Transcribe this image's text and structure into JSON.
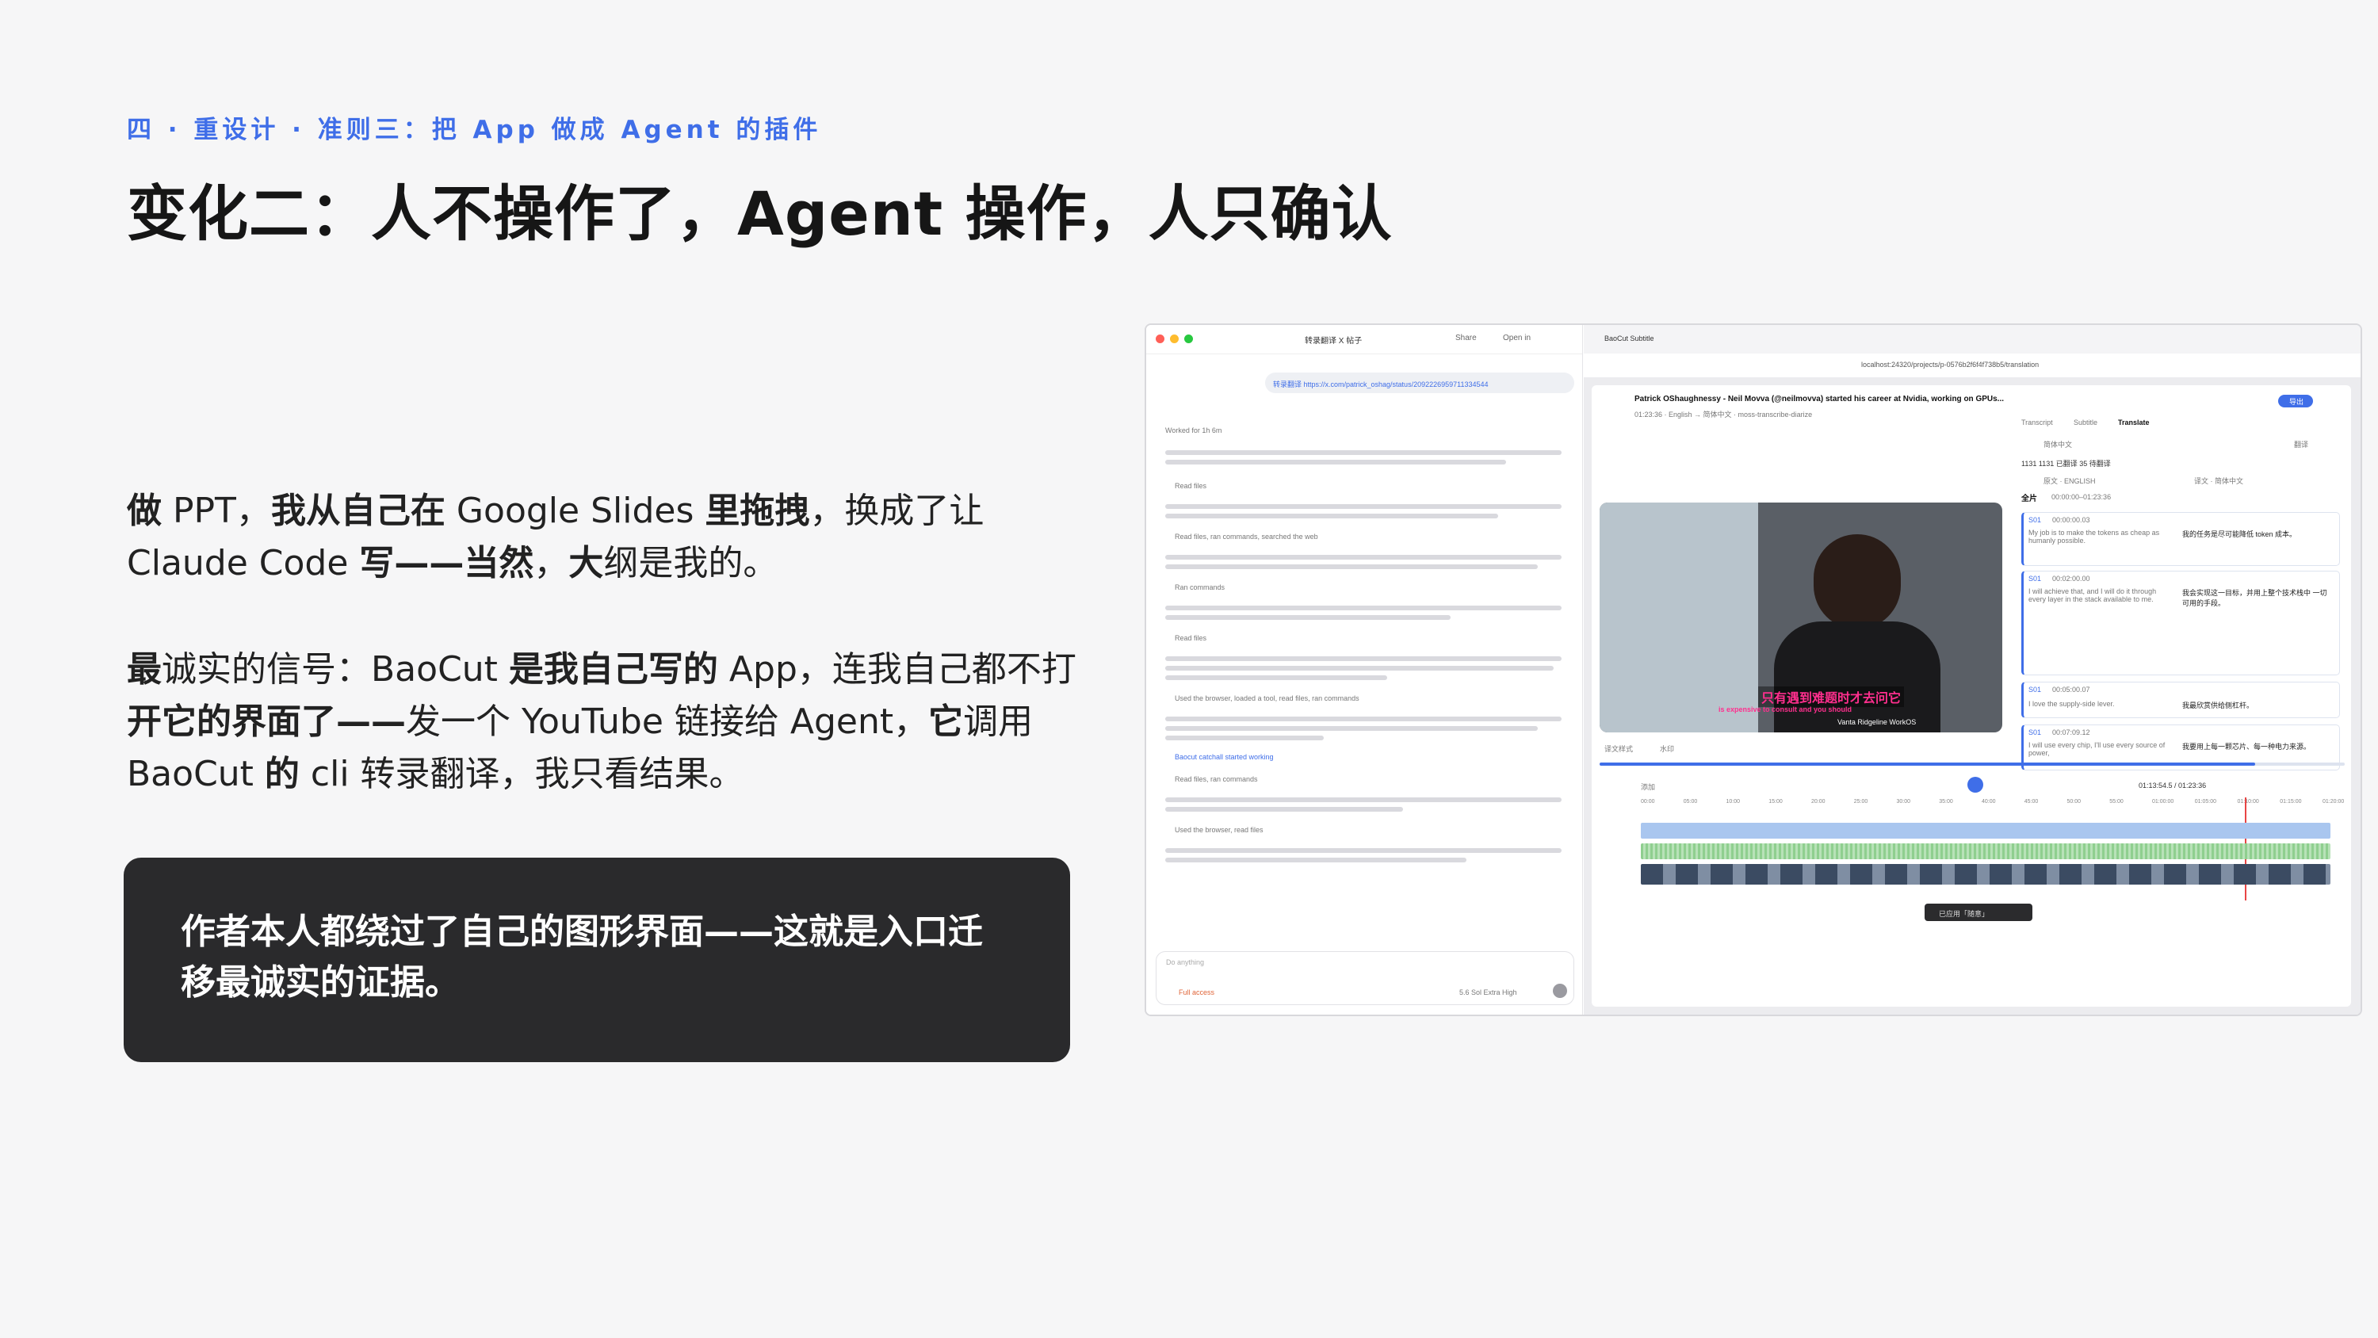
{
  "slide": {
    "kicker": "四 · 重设计 · 准则三：把 App 做成 Agent 的插件",
    "title": "变化二：人不操作了，Agent 操作，人只确认",
    "p1": {
      "b1": "做",
      "t1": " PPT，",
      "b2": "我从自己在",
      "t2": " Google Slides ",
      "b3": "里拖拽",
      "t3": "，换成了让 Claude Code ",
      "b4": "写——当然",
      "t4": "，",
      "b5": "大",
      "t5": "纲是我的。"
    },
    "p2": {
      "b1": "最",
      "t1": "诚实的信号：BaoCut ",
      "b2": "是我自己写的",
      "t2": " App，连我自己都不打",
      "b3": "开它的界面了——",
      "t3": "发一个 YouTube 链接给 Agent，",
      "b4": "它",
      "t4": "调用 BaoCut ",
      "b5": "的",
      "t5": " cli 转录翻译，我只看结果。"
    },
    "callout": "作者本人都绕过了自己的图形界面——这就是入口迁移最诚实的证据。"
  },
  "screenshot": {
    "left": {
      "tab": "转录翻译 X 帖子",
      "share": "Share",
      "open_in": "Open in",
      "msg": "转录翻译 https://x.com/patrick_oshag/status/2092226959711334544",
      "worked": "Worked for 1h 6m",
      "read_files": "Read files",
      "read_ran_web": "Read files, ran commands, searched the web",
      "ran_commands": "Ran commands",
      "used_browser": "Used the browser, loaded a tool, read files, ran commands",
      "baocut_catchall": "Baocut catchall  started working",
      "read_ran": "Read files, ran commands",
      "browser_read": "Used the browser, read files",
      "ask": "Do anything",
      "full_access": "Full access",
      "model": "5.6 Sol Extra High"
    },
    "right": {
      "tab": "BaoCut Subtitle",
      "url": "localhost:24320/projects/p-0576b2f6f4f738b5/translation",
      "video_title": "Patrick OShaughnessy - Neil Movva (@neilmovva) started his career at Nvidia, working on GPUs...",
      "meta": "01:23:36 · English → 简体中文 · moss-transcribe-diarize",
      "export": "导出",
      "tabs": [
        "Transcript",
        "Subtitle",
        "Translate"
      ],
      "lang": "简体中文",
      "translate_btn": "翻译",
      "stats": "1131  1131 已翻译  35 待翻译",
      "col_src": "原文 · ENGLISH",
      "col_tgt": "译文 · 简体中文",
      "section": "全片",
      "section_time": "00:00:00–01:23:36",
      "subtitle_cn": "只有遇到难题时才去问它",
      "subtitle_en": "is expensive to consult and you should",
      "logos": "Vanta   Ridgeline   WorkOS",
      "rows": [
        {
          "id": "S01",
          "time": "00:00:00.03",
          "en": "My job is to make the tokens as cheap as humanly possible.",
          "zh": "我的任务是尽可能降低 token 成本。"
        },
        {
          "id": "S01",
          "time": "00:02:00.00",
          "en": "I will achieve that, and I will do it through every layer in the stack available to me.",
          "zh": "我会实现这一目标，并用上整个技术栈中 一切可用的手段。"
        },
        {
          "id": "S01",
          "time": "00:05:00.07",
          "en": "I love the supply-side lever.",
          "zh": "我最欣赏供给侧杠杆。"
        },
        {
          "id": "S01",
          "time": "00:07:09.12",
          "en": "I will use every chip, I'll use every source of power,",
          "zh": "我要用上每一颗芯片、每一种电力来源。"
        }
      ],
      "sub_style": "译文样式",
      "watermark": "水印",
      "add": "添加",
      "timecode": "01:13:54.5 / 01:23:36",
      "toast": "已应用「随意」",
      "timeline_ticks": [
        "00:00",
        "05:00",
        "10:00",
        "15:00",
        "20:00",
        "25:00",
        "30:00",
        "35:00",
        "40:00",
        "45:00",
        "50:00",
        "55:00",
        "01:00:00",
        "01:05:00",
        "01:10:00",
        "01:15:00",
        "01:20:00"
      ]
    }
  },
  "colors": {
    "accent_blue": "#3f6ee8",
    "dark_callout": "#2a2a2c",
    "bg": "#f6f6f7",
    "subtitle_pink": "#ff2f8e"
  },
  "icons": [
    "close-dot",
    "minimize-dot",
    "maximize-dot",
    "play-icon",
    "search-icon",
    "plus-icon",
    "mic-icon",
    "send-icon"
  ]
}
